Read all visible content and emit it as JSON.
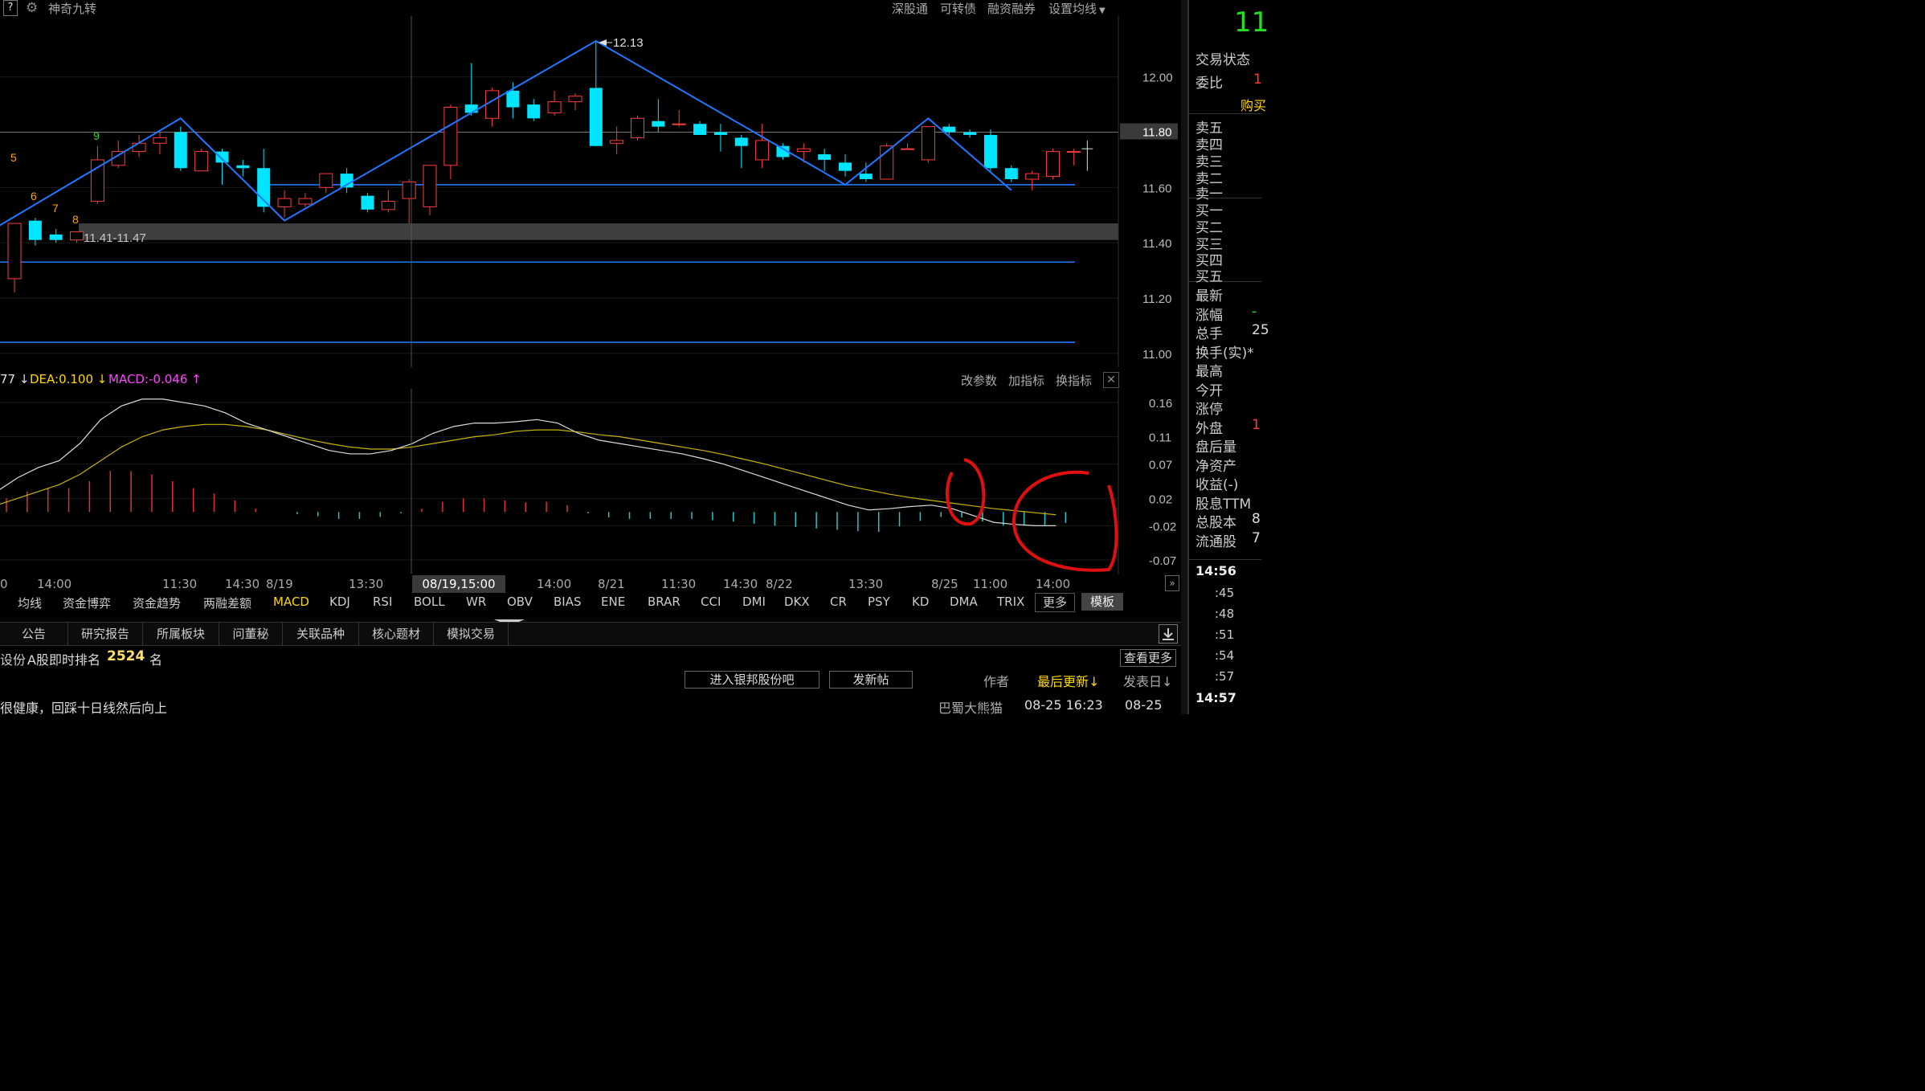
{
  "topbar": {
    "help": "?",
    "indicator_name": "神奇九转",
    "links": [
      "深股通",
      "可转债",
      "融资融券",
      "设置均线"
    ]
  },
  "main": {
    "price_axis": [
      "12.00",
      "11.80",
      "11.60",
      "11.40",
      "11.20",
      "11.00"
    ],
    "current_price_tag": "11.80",
    "high_label": "12.13",
    "zone_label": "11.41-11.47",
    "td_numbers": [
      "5",
      "6",
      "7",
      "8",
      "9"
    ]
  },
  "macd": {
    "dif_label": "77",
    "dea_label": "DEA:0.100",
    "macd_label": "MACD:-0.046",
    "buttons": [
      "改参数",
      "加指标",
      "换指标"
    ],
    "axis": [
      "0.16",
      "0.11",
      "0.07",
      "0.02",
      "-0.02",
      "-0.07"
    ]
  },
  "time_axis": {
    "labels": [
      "0",
      "14:00",
      "11:30",
      "14:30",
      "8/19",
      "13:30",
      "14:00",
      "8/21",
      "11:30",
      "14:30",
      "8/22",
      "13:30",
      "8/25",
      "11:00",
      "14:00"
    ],
    "cursor": "08/19,15:00"
  },
  "indicator_tabs": [
    "均线",
    "资金博弈",
    "资金趋势",
    "两融差额",
    "MACD",
    "KDJ",
    "RSI",
    "BOLL",
    "WR",
    "OBV",
    "BIAS",
    "ENE",
    "BRAR",
    "CCI",
    "DMI",
    "DKX",
    "CR",
    "PSY",
    "KD",
    "DMA",
    "TRIX"
  ],
  "more_label": "更多",
  "template_label": "模板",
  "info_tabs": [
    "公告",
    "研究报告",
    "所属板块",
    "问董秘",
    "关联品种",
    "核心题材",
    "模拟交易"
  ],
  "rank": {
    "prefix": "设份",
    "label": "A股即时排名",
    "value": "2524",
    "unit": "名",
    "more": "查看更多"
  },
  "forum": {
    "enter": "进入银邦股份吧",
    "post": "发新帖",
    "author": "作者",
    "last_update": "最后更新",
    "post_date": "发表日"
  },
  "post": {
    "title": "很健康，回踩十日线然后向上",
    "author": "巴蜀大熊猫",
    "updated": "08-25 16:23",
    "date": "08-25"
  },
  "right_panel": {
    "price": "11",
    "labels": [
      "交易状态",
      "委比"
    ],
    "buy_header": "购买",
    "sell": [
      "卖五",
      "卖四",
      "卖三",
      "卖二",
      "卖一"
    ],
    "buy": [
      "买一",
      "买二",
      "买三",
      "买四",
      "买五"
    ],
    "stats": [
      "最新",
      "涨幅",
      "总手",
      "换手(实)*",
      "最高",
      "今开",
      "涨停",
      "外盘",
      "盘后量",
      "净资产",
      "收益(-)",
      "股息TTM",
      "总股本",
      "流通股"
    ],
    "stat_values": [
      "",
      "-",
      "25",
      "",
      "",
      "",
      "",
      "1",
      "",
      "",
      "",
      "",
      "8",
      "7"
    ],
    "times": [
      "14:56",
      ":45",
      ":48",
      ":51",
      ":54",
      ":57",
      "14:57"
    ]
  },
  "colors": {
    "up": "#ff3b3b",
    "down": "#00e5ff",
    "trend": "#1e78ff",
    "dif": "#e0e0e0",
    "dea": "#c8b400"
  },
  "chart_data": {
    "type": "candlestick",
    "ylim": [
      10.95,
      12.22
    ],
    "candles": [
      {
        "o": 11.27,
        "h": 11.32,
        "l": 11.22,
        "c": 11.47
      },
      {
        "o": 11.48,
        "h": 11.49,
        "l": 11.39,
        "c": 11.41
      },
      {
        "o": 11.43,
        "h": 11.45,
        "l": 11.4,
        "c": 11.41
      },
      {
        "o": 11.41,
        "h": 11.44,
        "l": 11.4,
        "c": 11.44
      },
      {
        "o": 11.55,
        "h": 11.75,
        "l": 11.54,
        "c": 11.7
      },
      {
        "o": 11.68,
        "h": 11.77,
        "l": 11.67,
        "c": 11.73
      },
      {
        "o": 11.73,
        "h": 11.79,
        "l": 11.71,
        "c": 11.76
      },
      {
        "o": 11.76,
        "h": 11.8,
        "l": 11.72,
        "c": 11.78
      },
      {
        "o": 11.8,
        "h": 11.82,
        "l": 11.66,
        "c": 11.67
      },
      {
        "o": 11.66,
        "h": 11.74,
        "l": 11.66,
        "c": 11.73
      },
      {
        "o": 11.73,
        "h": 11.74,
        "l": 11.61,
        "c": 11.69
      },
      {
        "o": 11.68,
        "h": 11.7,
        "l": 11.64,
        "c": 11.67
      },
      {
        "o": 11.67,
        "h": 11.74,
        "l": 11.51,
        "c": 11.53
      },
      {
        "o": 11.53,
        "h": 11.59,
        "l": 11.49,
        "c": 11.56
      },
      {
        "o": 11.54,
        "h": 11.58,
        "l": 11.53,
        "c": 11.56
      },
      {
        "o": 11.6,
        "h": 11.64,
        "l": 11.58,
        "c": 11.65
      },
      {
        "o": 11.65,
        "h": 11.67,
        "l": 11.58,
        "c": 11.6
      },
      {
        "o": 11.57,
        "h": 11.58,
        "l": 11.51,
        "c": 11.52
      },
      {
        "o": 11.52,
        "h": 11.59,
        "l": 11.51,
        "c": 11.55
      },
      {
        "o": 11.56,
        "h": 11.63,
        "l": 11.47,
        "c": 11.62
      },
      {
        "o": 11.53,
        "h": 11.66,
        "l": 11.5,
        "c": 11.68
      },
      {
        "o": 11.68,
        "h": 11.9,
        "l": 11.63,
        "c": 11.89
      },
      {
        "o": 11.9,
        "h": 12.05,
        "l": 11.86,
        "c": 11.87
      },
      {
        "o": 11.85,
        "h": 11.96,
        "l": 11.82,
        "c": 11.95
      },
      {
        "o": 11.95,
        "h": 11.98,
        "l": 11.85,
        "c": 11.89
      },
      {
        "o": 11.9,
        "h": 11.92,
        "l": 11.84,
        "c": 11.85
      },
      {
        "o": 11.87,
        "h": 11.95,
        "l": 11.86,
        "c": 11.91
      },
      {
        "o": 11.91,
        "h": 11.94,
        "l": 11.88,
        "c": 11.93
      },
      {
        "o": 11.96,
        "h": 12.13,
        "l": 11.75,
        "c": 11.75
      },
      {
        "o": 11.76,
        "h": 11.82,
        "l": 11.72,
        "c": 11.77
      },
      {
        "o": 11.78,
        "h": 11.86,
        "l": 11.77,
        "c": 11.85
      },
      {
        "o": 11.84,
        "h": 11.92,
        "l": 11.8,
        "c": 11.82
      },
      {
        "o": 11.83,
        "h": 11.88,
        "l": 11.82,
        "c": 11.83
      },
      {
        "o": 11.83,
        "h": 11.84,
        "l": 11.79,
        "c": 11.79
      },
      {
        "o": 11.8,
        "h": 11.83,
        "l": 11.73,
        "c": 11.79
      },
      {
        "o": 11.78,
        "h": 11.79,
        "l": 11.67,
        "c": 11.75
      },
      {
        "o": 11.7,
        "h": 11.83,
        "l": 11.67,
        "c": 11.77
      },
      {
        "o": 11.75,
        "h": 11.76,
        "l": 11.7,
        "c": 11.71
      },
      {
        "o": 11.73,
        "h": 11.76,
        "l": 11.69,
        "c": 11.74
      },
      {
        "o": 11.72,
        "h": 11.74,
        "l": 11.66,
        "c": 11.7
      },
      {
        "o": 11.69,
        "h": 11.72,
        "l": 11.64,
        "c": 11.66
      },
      {
        "o": 11.65,
        "h": 11.69,
        "l": 11.62,
        "c": 11.63
      },
      {
        "o": 11.63,
        "h": 11.76,
        "l": 11.63,
        "c": 11.75
      },
      {
        "o": 11.74,
        "h": 11.76,
        "l": 11.74,
        "c": 11.74
      },
      {
        "o": 11.7,
        "h": 11.82,
        "l": 11.69,
        "c": 11.82
      },
      {
        "o": 11.82,
        "h": 11.83,
        "l": 11.79,
        "c": 11.8
      },
      {
        "o": 11.8,
        "h": 11.81,
        "l": 11.78,
        "c": 11.79
      },
      {
        "o": 11.79,
        "h": 11.81,
        "l": 11.66,
        "c": 11.67
      },
      {
        "o": 11.67,
        "h": 11.68,
        "l": 11.62,
        "c": 11.63
      },
      {
        "o": 11.63,
        "h": 11.66,
        "l": 11.59,
        "c": 11.65
      },
      {
        "o": 11.64,
        "h": 11.74,
        "l": 11.63,
        "c": 11.73
      },
      {
        "o": 11.73,
        "h": 11.74,
        "l": 11.68,
        "c": 11.73
      }
    ],
    "trend_lines": [
      [
        [
          -1,
          11.45
        ],
        [
          8,
          11.85
        ],
        [
          13,
          11.48
        ],
        [
          28,
          12.13
        ],
        [
          40,
          11.61
        ],
        [
          44,
          11.85
        ],
        [
          48,
          11.59
        ]
      ]
    ],
    "horizontal_lines": [
      11.8,
      11.61,
      11.33,
      11.04
    ],
    "zone": [
      11.41,
      11.47
    ],
    "macd": {
      "ylim": [
        -0.09,
        0.18
      ],
      "dif": [
        0.03,
        0.05,
        0.065,
        0.075,
        0.1,
        0.135,
        0.155,
        0.165,
        0.165,
        0.16,
        0.155,
        0.145,
        0.13,
        0.12,
        0.11,
        0.1,
        0.09,
        0.085,
        0.085,
        0.09,
        0.1,
        0.115,
        0.125,
        0.13,
        0.13,
        0.132,
        0.135,
        0.13,
        0.115,
        0.105,
        0.1,
        0.095,
        0.09,
        0.085,
        0.078,
        0.07,
        0.06,
        0.05,
        0.04,
        0.03,
        0.02,
        0.01,
        0.003,
        0.005,
        0.008,
        0.01,
        0.005,
        -0.005,
        -0.015,
        -0.018,
        -0.02,
        -0.02
      ],
      "dea": [
        0.01,
        0.02,
        0.03,
        0.04,
        0.055,
        0.075,
        0.095,
        0.11,
        0.12,
        0.125,
        0.128,
        0.128,
        0.125,
        0.12,
        0.113,
        0.106,
        0.1,
        0.095,
        0.092,
        0.092,
        0.095,
        0.1,
        0.105,
        0.11,
        0.113,
        0.118,
        0.12,
        0.12,
        0.117,
        0.113,
        0.11,
        0.105,
        0.1,
        0.095,
        0.09,
        0.084,
        0.077,
        0.07,
        0.062,
        0.054,
        0.046,
        0.038,
        0.032,
        0.026,
        0.021,
        0.017,
        0.013,
        0.009,
        0.005,
        0.002,
        -0.001,
        -0.004
      ],
      "hist": [
        0.02,
        0.03,
        0.035,
        0.035,
        0.045,
        0.06,
        0.06,
        0.055,
        0.045,
        0.035,
        0.027,
        0.017,
        0.005,
        0.0,
        -0.003,
        -0.006,
        -0.01,
        -0.01,
        -0.007,
        -0.002,
        0.005,
        0.015,
        0.02,
        0.02,
        0.017,
        0.014,
        0.015,
        0.01,
        -0.002,
        -0.008,
        -0.01,
        -0.01,
        -0.01,
        -0.01,
        -0.012,
        -0.014,
        -0.017,
        -0.02,
        -0.022,
        -0.024,
        -0.026,
        -0.028,
        -0.029,
        -0.021,
        -0.013,
        -0.007,
        -0.008,
        -0.014,
        -0.02,
        -0.02,
        -0.019,
        -0.016
      ]
    }
  }
}
